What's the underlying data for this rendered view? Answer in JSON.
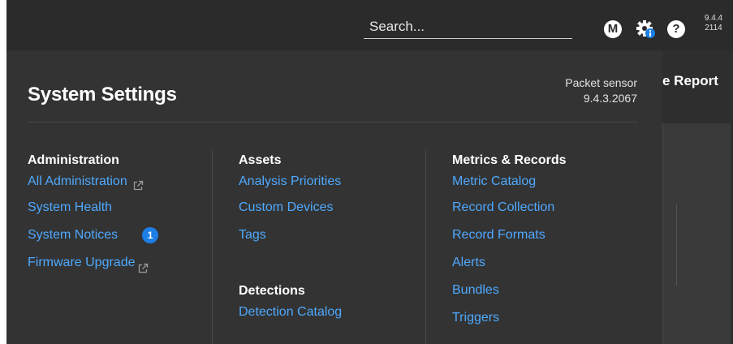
{
  "topbar": {
    "search_placeholder": "Search...",
    "user_initial": "M",
    "help_symbol": "?",
    "version_line1": "9.4.4",
    "version_line2": "2114"
  },
  "background": {
    "title_fragment": "e Report"
  },
  "panel": {
    "title": "System Settings",
    "sensor_type": "Packet sensor",
    "sensor_version": "9.4.3.2067",
    "columns": [
      {
        "heading": "Administration",
        "links": [
          {
            "label": "All Administration",
            "external": true
          },
          {
            "label": "System Health"
          },
          {
            "label": "System Notices",
            "badge": "1"
          },
          {
            "label": "Firmware Upgrade",
            "external": true
          }
        ]
      },
      {
        "heading": "Assets",
        "links": [
          {
            "label": "Analysis Priorities"
          },
          {
            "label": "Custom Devices"
          },
          {
            "label": "Tags"
          }
        ],
        "heading2": "Detections",
        "links2": [
          {
            "label": "Detection Catalog"
          }
        ]
      },
      {
        "heading": "Metrics & Records",
        "links": [
          {
            "label": "Metric Catalog"
          },
          {
            "label": "Record Collection"
          },
          {
            "label": "Record Formats"
          },
          {
            "label": "Alerts"
          },
          {
            "label": "Bundles"
          },
          {
            "label": "Triggers"
          }
        ]
      }
    ]
  },
  "icons": {
    "user": "user-avatar-icon",
    "settings": "gear-info-icon",
    "help": "help-icon",
    "external": "external-link-icon"
  },
  "colors": {
    "link": "#4ea9ff",
    "badge": "#1c7fe6",
    "panel_bg": "#333333",
    "topbar_bg": "#2b2b2b"
  }
}
